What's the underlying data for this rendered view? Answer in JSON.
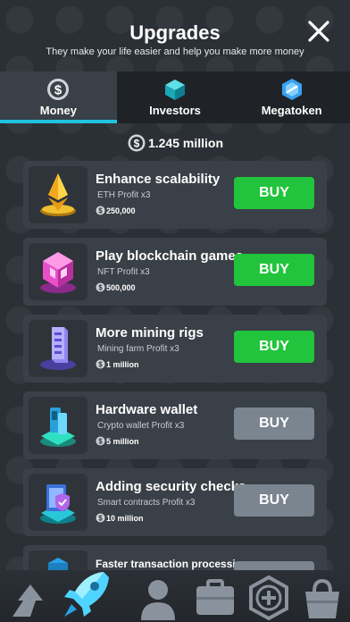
{
  "header": {
    "title": "Upgrades",
    "subtitle": "They make your life easier and help you make more money"
  },
  "tabs": [
    {
      "label": "Money",
      "icon": "dollar-coin-icon",
      "active": true
    },
    {
      "label": "Investors",
      "icon": "cube-icon",
      "active": false
    },
    {
      "label": "Megatoken",
      "icon": "token-icon",
      "active": false
    }
  ],
  "balance": {
    "value": "1.245 million",
    "icon": "dollar-coin-icon"
  },
  "upgrades": [
    {
      "title": "Enhance scalability",
      "desc": "ETH Profit x3",
      "price": "250,000",
      "buy_label": "BUY",
      "enabled": true,
      "icon": "ethereum-icon"
    },
    {
      "title": "Play blockchain games",
      "desc": "NFT Profit x3",
      "price": "500,000",
      "buy_label": "BUY",
      "enabled": true,
      "icon": "game-cube-icon"
    },
    {
      "title": "More mining rigs",
      "desc": "Mining farm Profit x3",
      "price": "1 million",
      "buy_label": "BUY",
      "enabled": true,
      "icon": "server-rack-icon"
    },
    {
      "title": "Hardware wallet",
      "desc": "Crypto wallet Profit x3",
      "price": "5 million",
      "buy_label": "BUY",
      "enabled": false,
      "icon": "hardware-wallet-icon"
    },
    {
      "title": "Adding security checks",
      "desc": "Smart contracts Profit x3",
      "price": "10 million",
      "buy_label": "BUY",
      "enabled": false,
      "icon": "security-shield-icon"
    },
    {
      "title": "Faster transaction processing",
      "desc": "",
      "price": "",
      "buy_label": "",
      "enabled": false,
      "icon": "transaction-icon"
    }
  ],
  "bottom_nav": [
    {
      "name": "upgrades-arrow-icon"
    },
    {
      "name": "rocket-icon"
    },
    {
      "name": "profile-icon"
    },
    {
      "name": "briefcase-icon"
    },
    {
      "name": "hexagon-plus-icon"
    },
    {
      "name": "shopping-bag-icon"
    }
  ],
  "colors": {
    "accent": "#1fc3e0",
    "buy_enabled": "#21c43c",
    "buy_disabled": "#7b8590",
    "card": "#3a4047",
    "background": "#2b3036"
  }
}
